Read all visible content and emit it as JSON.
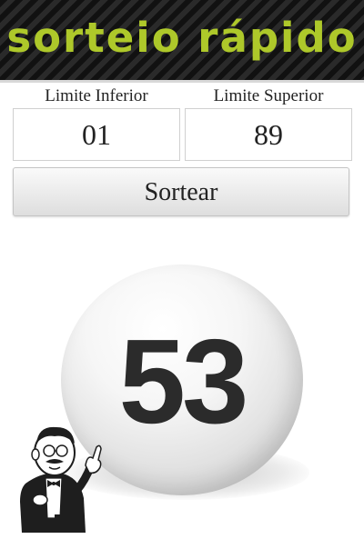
{
  "header": {
    "title": "sorteio rápido",
    "accent_color": "#aec82a"
  },
  "range": {
    "lower_label": "Limite Inferior",
    "lower_value": "01",
    "upper_label": "Limite Superior",
    "upper_value": "89"
  },
  "draw_button": {
    "label": "Sortear"
  },
  "result": {
    "number": "53"
  },
  "mascot": {
    "icon": "waiter-mascot-icon"
  }
}
